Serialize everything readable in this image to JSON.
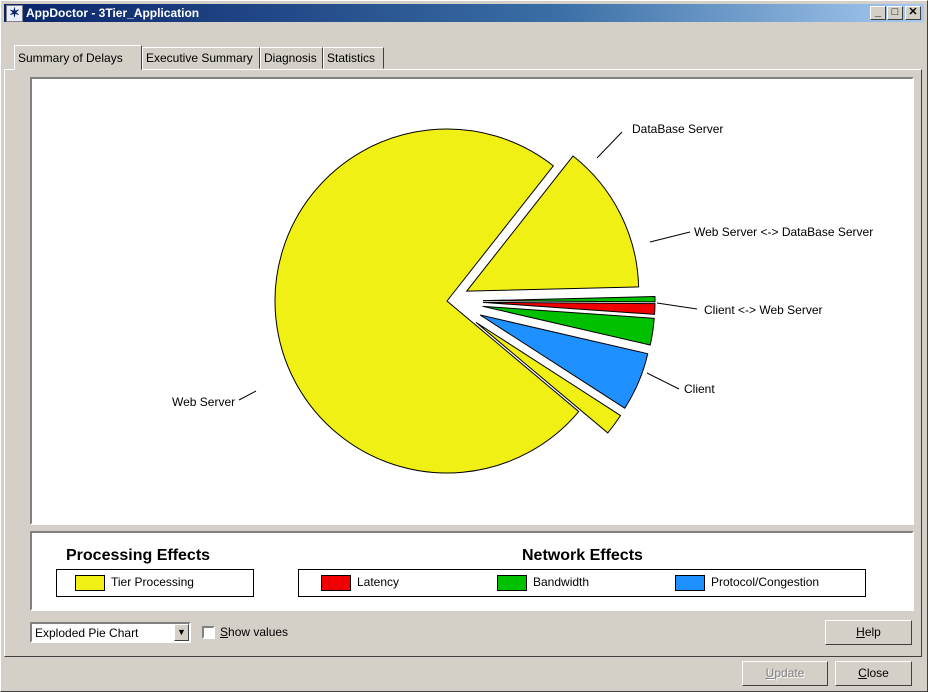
{
  "window": {
    "title": "AppDoctor - 3Tier_Application",
    "app_icon": "appdoctor-star-icon"
  },
  "tabs": [
    {
      "label": "Summary of Delays",
      "active": true
    },
    {
      "label": "Executive Summary",
      "active": false
    },
    {
      "label": "Diagnosis",
      "active": false
    },
    {
      "label": "Statistics",
      "active": false
    }
  ],
  "chart_data": {
    "type": "pie",
    "variant": "exploded",
    "slices": [
      {
        "label": "Web Server",
        "value": 74.5,
        "effect": "Tier Processing",
        "color": "#f0f014",
        "exploded": false
      },
      {
        "label": "DataBase Server",
        "value": 14.0,
        "effect": "Tier Processing",
        "color": "#f0f014",
        "exploded": true
      },
      {
        "label": "Web Server <-> DataBase Server",
        "value": 0.5,
        "effect": "Bandwidth",
        "color": "#00c000",
        "exploded": true
      },
      {
        "label": "",
        "value": 1.0,
        "effect": "Latency",
        "color": "#f00000",
        "exploded": true
      },
      {
        "label": "",
        "value": 2.5,
        "effect": "Bandwidth",
        "color": "#00c000",
        "exploded": true
      },
      {
        "label": "Client <-> Web Server",
        "value": 5.5,
        "effect": "Protocol/Congestion",
        "color": "#1e90ff",
        "exploded": true
      },
      {
        "label": "Client",
        "value": 2.0,
        "effect": "Tier Processing",
        "color": "#f0f014",
        "exploded": true
      }
    ]
  },
  "legend": {
    "processing_heading": "Processing Effects",
    "network_heading": "Network Effects",
    "processing_items": [
      {
        "label": "Tier Processing",
        "color": "#f0f014"
      }
    ],
    "network_items": [
      {
        "label": "Latency",
        "color": "#f00000"
      },
      {
        "label": "Bandwidth",
        "color": "#00c000"
      },
      {
        "label": "Protocol/Congestion",
        "color": "#1e90ff"
      }
    ]
  },
  "controls": {
    "chart_type_selected": "Exploded Pie Chart",
    "show_values_label": "Show values",
    "show_values_checked": false,
    "help_label": "Help",
    "update_label": "Update",
    "close_label": "Close"
  }
}
